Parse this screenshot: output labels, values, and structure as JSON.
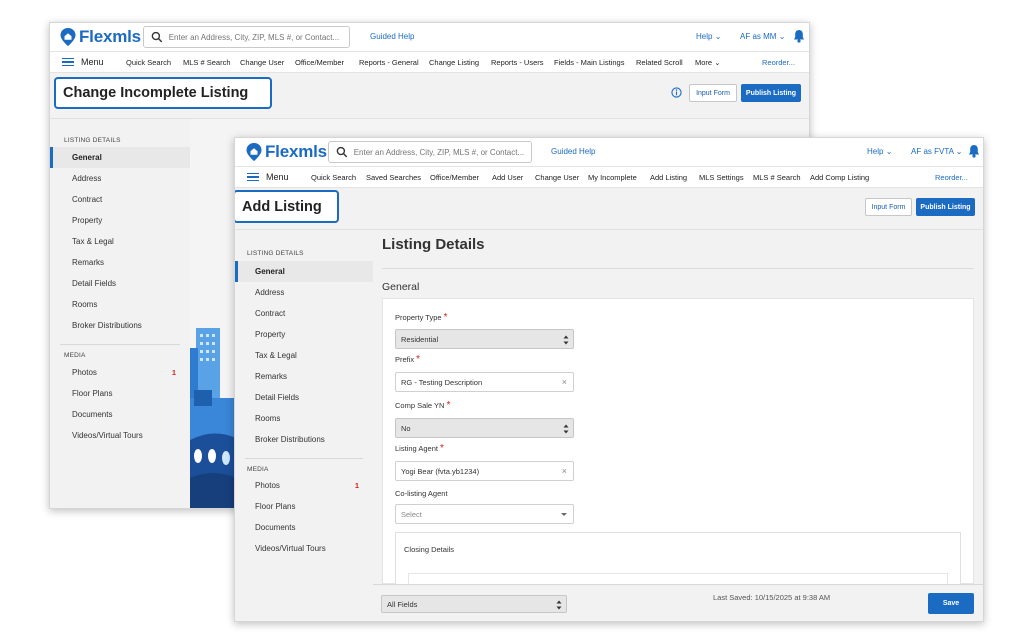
{
  "window_back": {
    "brand": "Flexmls",
    "search_placeholder": "Enter an Address, City, ZIP, MLS #, or Contact...",
    "guided_help": "Guided Help",
    "help": "Help",
    "user": "AF as MM",
    "menu": "Menu",
    "nav": [
      "Quick Search",
      "MLS # Search",
      "Change User",
      "Office/Member",
      "Reports - General",
      "Change Listing",
      "Reports - Users",
      "Fields - Main Listings",
      "Related Scroll",
      "More"
    ],
    "reorder": "Reorder...",
    "page_title": "Change Incomplete Listing",
    "input_form": "Input Form",
    "publish": "Publish Listing",
    "listing_details_head": "LISTING DETAILS",
    "listing_items": [
      "General",
      "Address",
      "Contract",
      "Property",
      "Tax & Legal",
      "Remarks",
      "Detail Fields",
      "Rooms",
      "Broker Distributions"
    ],
    "media_head": "MEDIA",
    "media_items": [
      "Photos",
      "Floor Plans",
      "Documents",
      "Videos/Virtual Tours"
    ],
    "photos_badge": "1"
  },
  "window_front": {
    "brand": "Flexmls",
    "search_placeholder": "Enter an Address, City, ZIP, MLS #, or Contact...",
    "guided_help": "Guided Help",
    "help": "Help",
    "user": "AF as FVTA",
    "menu": "Menu",
    "nav": [
      "Quick Search",
      "Saved Searches",
      "Office/Member",
      "Add User",
      "Change User",
      "My Incomplete",
      "Add Listing",
      "MLS Settings",
      "MLS # Search",
      "Add Comp Listing"
    ],
    "reorder": "Reorder...",
    "page_title": "Add Listing",
    "input_form": "Input Form",
    "publish": "Publish Listing",
    "listing_details_head": "LISTING DETAILS",
    "listing_items": [
      "General",
      "Address",
      "Contract",
      "Property",
      "Tax & Legal",
      "Remarks",
      "Detail Fields",
      "Rooms",
      "Broker Distributions"
    ],
    "media_head": "MEDIA",
    "media_items": [
      "Photos",
      "Floor Plans",
      "Documents",
      "Videos/Virtual Tours"
    ],
    "photos_badge": "1",
    "main_heading": "Listing Details",
    "section_heading": "General",
    "fields": {
      "property_type_label": "Property Type",
      "property_type_value": "Residential",
      "prefix_label": "Prefix",
      "prefix_value": "RG - Testing Description",
      "comp_sale_label": "Comp Sale YN",
      "comp_sale_value": "No",
      "listing_agent_label": "Listing Agent",
      "listing_agent_value": "Yogi Bear (fvta.yb1234)",
      "colisting_label": "Co-listing Agent",
      "colisting_placeholder": "Select",
      "required_mark": "*"
    },
    "closing_details": "Closing Details",
    "footer": {
      "filter_value": "All Fields",
      "last_saved": "Last Saved: 10/15/2025 at 9:38 AM",
      "save": "Save"
    }
  },
  "colors": {
    "brand_blue": "#1b6bc2",
    "required_red": "#d0231f",
    "sidebar_bg": "#f2f2f2"
  }
}
